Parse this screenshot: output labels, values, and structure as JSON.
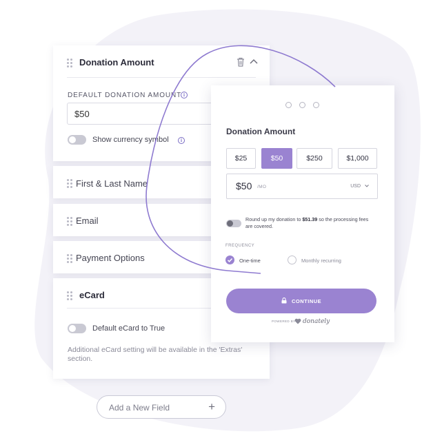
{
  "builder": {
    "donation_amount": {
      "title": "Donation Amount",
      "default_label": "DEFAULT DONATION AMOUNT",
      "default_value": "$50",
      "currency_toggle_label": "Show currency symbol"
    },
    "fields": [
      {
        "label": "First & Last Name"
      },
      {
        "label": "Email"
      },
      {
        "label": "Payment Options"
      }
    ],
    "ecard": {
      "title": "eCard",
      "toggle_label": "Default eCard to True",
      "help_text": "Additional eCard setting will be available in the 'Extras' section."
    },
    "add_field": {
      "label": "Add a New Field",
      "plus": "+"
    }
  },
  "form": {
    "title": "Donation Amount",
    "amounts": [
      {
        "label": "$25",
        "selected": false
      },
      {
        "label": "$50",
        "selected": true
      },
      {
        "label": "$250",
        "selected": false
      },
      {
        "label": "$1,000",
        "selected": false
      }
    ],
    "custom_amount": {
      "value": "$50",
      "period": "/MO",
      "currency": "USD"
    },
    "round_up": {
      "text_before": "Round up my donation to ",
      "amount": "$51.39",
      "text_after": " so the processing fees are covered."
    },
    "frequency_label": "FREQUENCY",
    "frequency_options": [
      {
        "label": "One-time",
        "selected": true
      },
      {
        "label": "Monthly recurring",
        "selected": false
      }
    ],
    "continue_label": "CONTINUE",
    "powered_by": "POWERED BY",
    "brand": "donately"
  },
  "colors": {
    "accent": "#9a83d1",
    "background_blob": "#f3f2f8"
  }
}
